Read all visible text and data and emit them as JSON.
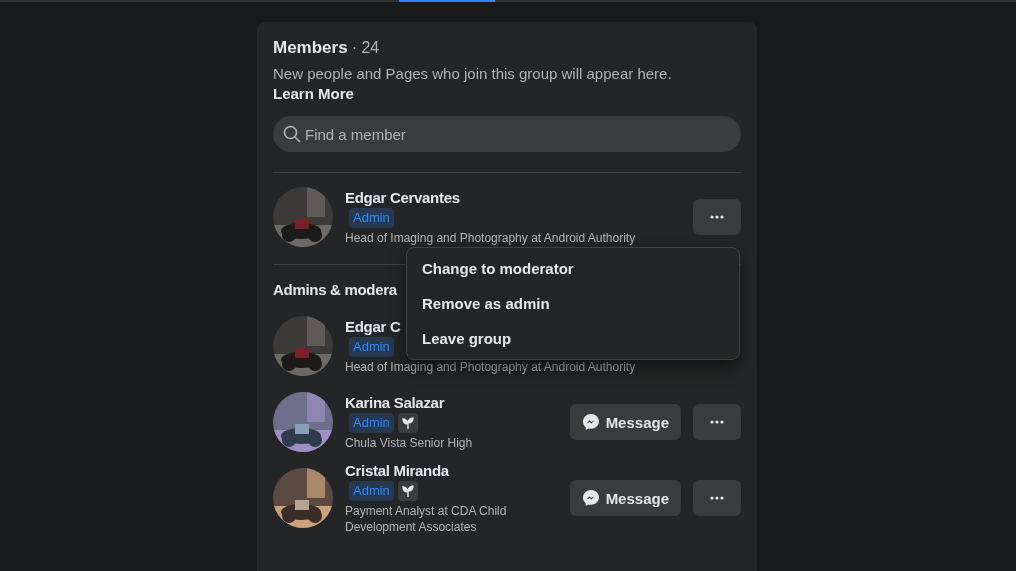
{
  "header": {
    "title": "Members",
    "count": "· 24",
    "description": "New people and Pages who join this group will appear here.",
    "link": "Learn More"
  },
  "search": {
    "placeholder": "Find a member"
  },
  "new_members": [
    {
      "name": "Edgar Cervantes",
      "badges": [
        {
          "kind": "label",
          "text": "Admin"
        }
      ],
      "subtitle": "Head of Imaging and Photography at Android Authority",
      "actions": [
        {
          "kind": "more"
        }
      ]
    }
  ],
  "menu": {
    "items": [
      "Change to moderator",
      "Remove as admin",
      "Leave group"
    ]
  },
  "section": {
    "title": "Admins & modera",
    "members": [
      {
        "name": "Edgar C",
        "badges": [
          {
            "kind": "label",
            "text": "Admin"
          }
        ],
        "subtitle": "Head of Imaging and Photography at Android Authority"
      },
      {
        "name": "Karina Salazar",
        "badges": [
          {
            "kind": "label",
            "text": "Admin"
          },
          {
            "kind": "icon"
          }
        ],
        "subtitle": "Chula Vista Senior High",
        "actions": [
          {
            "kind": "message",
            "label": "Message"
          },
          {
            "kind": "more"
          }
        ]
      },
      {
        "name": "Cristal Miranda",
        "badges": [
          {
            "kind": "label",
            "text": "Admin"
          },
          {
            "kind": "icon"
          }
        ],
        "subtitle": "Payment Analyst at CDA Child Development Associates",
        "actions": [
          {
            "kind": "message",
            "label": "Message"
          },
          {
            "kind": "more"
          }
        ]
      }
    ]
  }
}
